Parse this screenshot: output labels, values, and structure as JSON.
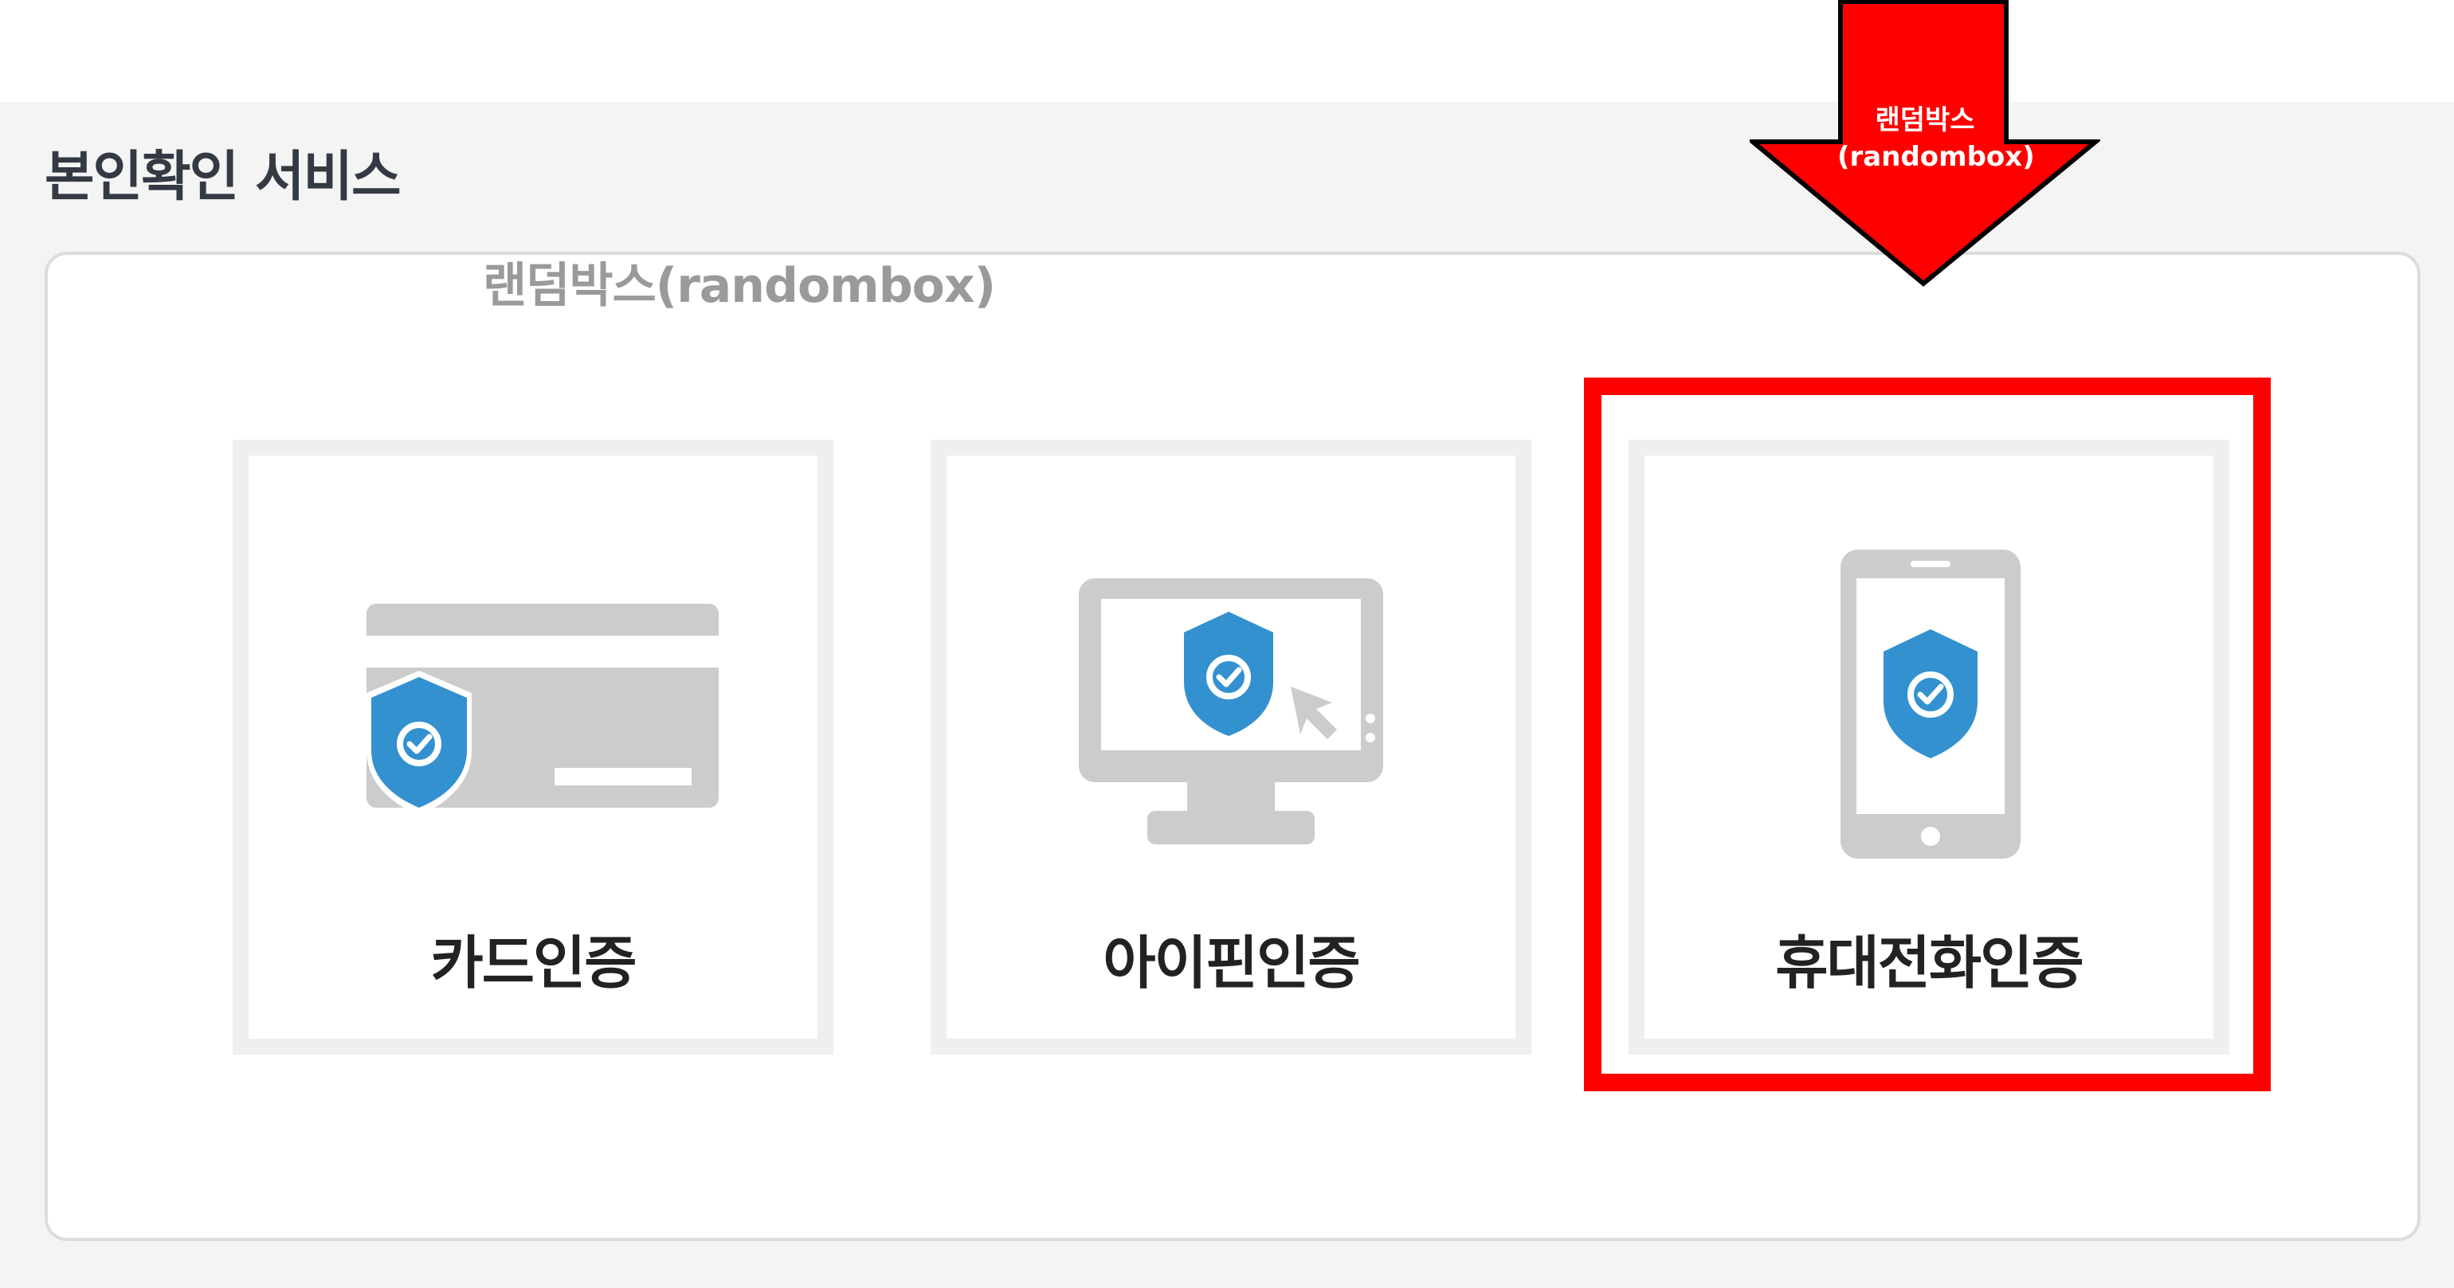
{
  "section": {
    "title": "본인확인 서비스",
    "caption": "랜덤박스(randombox)"
  },
  "options": [
    {
      "label": "카드인증",
      "icon": "card-shield-icon"
    },
    {
      "label": "아이핀인증",
      "icon": "monitor-shield-icon"
    },
    {
      "label": "휴대전화인증",
      "icon": "phone-shield-icon"
    }
  ],
  "annotation": {
    "line1": "랜덤박스",
    "line2": "(randombox)",
    "highlighted_option": "휴대전화인증"
  },
  "colors": {
    "shield_blue": "#3391cf",
    "icon_gray": "#cccccc",
    "highlight_red": "#ff0000",
    "page_bg": "#f4f4f4"
  }
}
